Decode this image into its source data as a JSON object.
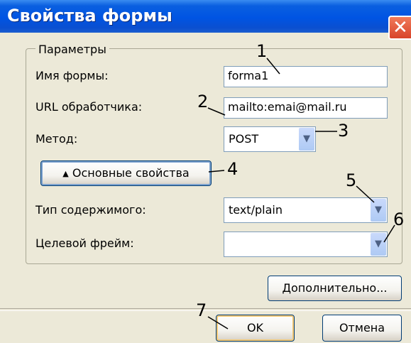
{
  "window": {
    "title": "Свойства формы"
  },
  "group": {
    "label": "Параметры"
  },
  "form_name": {
    "label": "Имя формы:",
    "value": "forma1"
  },
  "handler_url": {
    "label": "URL обработчика:",
    "value": "mailto:emai@mail.ru"
  },
  "method": {
    "label": "Метод:",
    "value": "POST"
  },
  "basic_props_button": {
    "icon": "triangle-up-icon",
    "label": "Основные свойства"
  },
  "content_type": {
    "label": "Тип содержимого:",
    "value": "text/plain"
  },
  "target_frame": {
    "label": "Целевой фрейм:",
    "value": ""
  },
  "buttons": {
    "advanced": "Дополнительно...",
    "ok": "OK",
    "cancel": "Отмена"
  },
  "callouts": [
    "1",
    "2",
    "3",
    "4",
    "5",
    "6",
    "7"
  ]
}
